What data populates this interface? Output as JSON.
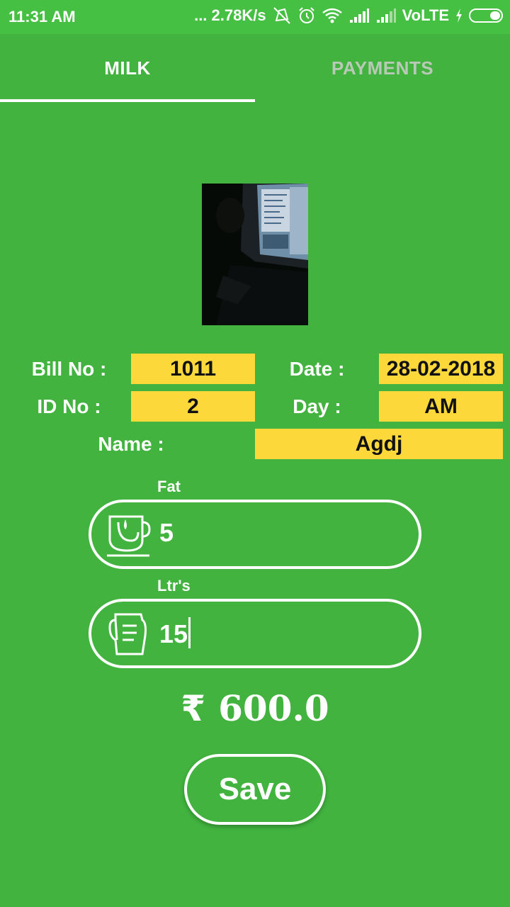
{
  "status_bar": {
    "time": "11:31 AM",
    "network_speed": "... 2.78K/s",
    "network_type": "VoLTE",
    "icons": [
      "mute-icon",
      "alarm-icon",
      "wifi-icon",
      "signal-icon",
      "signal-icon",
      "charging-icon",
      "battery-icon"
    ]
  },
  "tabs": [
    {
      "label": "MILK",
      "active": true
    },
    {
      "label": "PAYMENTS",
      "active": false
    }
  ],
  "form": {
    "bill_label": "Bill No :",
    "bill_value": "1011",
    "date_label": "Date :",
    "date_value": "28-02-2018",
    "id_label": "ID No :",
    "id_value": "2",
    "day_label": "Day :",
    "day_value": "AM",
    "name_label": "Name :",
    "name_value": "Agdj"
  },
  "fat": {
    "caption": "Fat",
    "value": "5",
    "icon": "cup-icon"
  },
  "liters": {
    "caption": "Ltr's",
    "value": "15",
    "icon": "jug-icon"
  },
  "total": {
    "currency_symbol": "₹",
    "amount": "600.0"
  },
  "save_label": "Save",
  "colors": {
    "background": "#41b33e",
    "status_bar": "#46c043",
    "value_box": "#fdd83a",
    "inactive_tab": "#b9c9b7"
  }
}
